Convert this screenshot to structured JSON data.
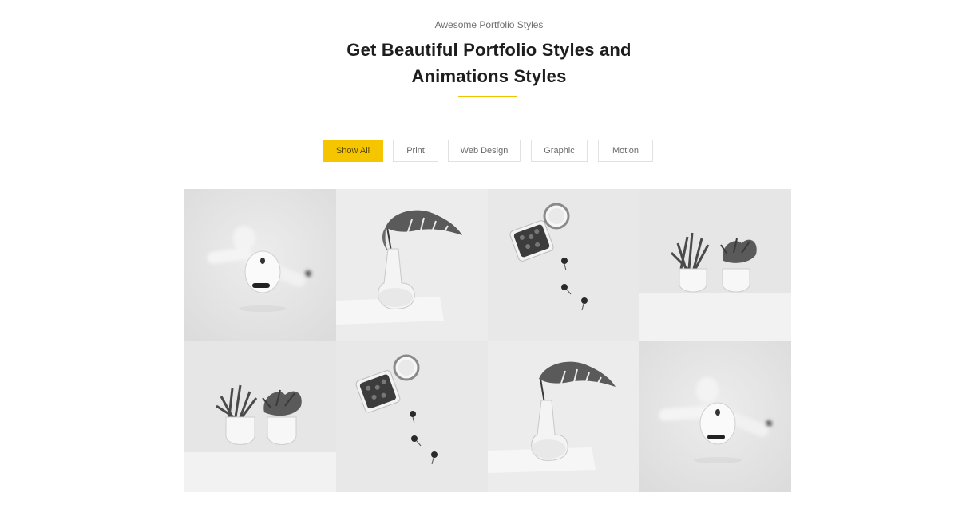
{
  "section": {
    "subtitle": "Awesome Portfolio Styles",
    "title_line1": "Get Beautiful Portfolio Styles and",
    "title_line2": "Animations Styles"
  },
  "filters": [
    {
      "label": "Show All",
      "active": true
    },
    {
      "label": "Print",
      "active": false
    },
    {
      "label": "Web Design",
      "active": false
    },
    {
      "label": "Graphic",
      "active": false
    },
    {
      "label": "Motion",
      "active": false
    }
  ],
  "colors": {
    "accent": "#f5c500",
    "tile_bg": "#e9e9e9"
  },
  "portfolio": [
    {
      "image": "earbuds-photo"
    },
    {
      "image": "plant-vase-photo"
    },
    {
      "image": "pins-jar-photo"
    },
    {
      "image": "potted-plants-photo"
    },
    {
      "image": "potted-plants-photo"
    },
    {
      "image": "pins-jar-photo"
    },
    {
      "image": "plant-vase-photo"
    },
    {
      "image": "earbuds-photo"
    }
  ]
}
